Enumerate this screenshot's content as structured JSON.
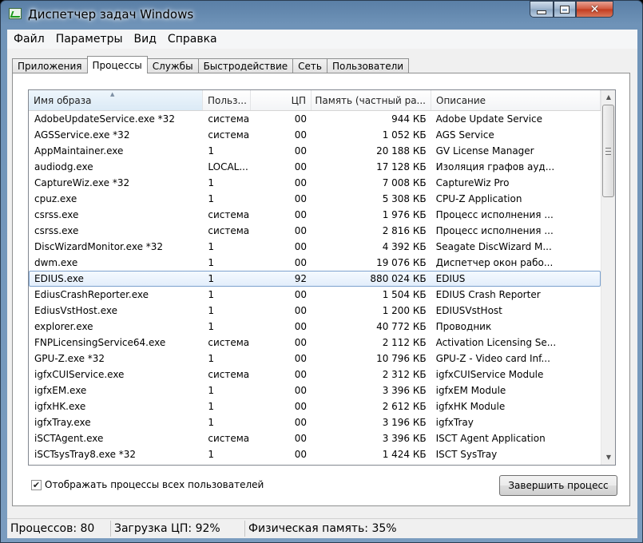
{
  "window": {
    "title": "Диспетчер задач Windows"
  },
  "menu": [
    "Файл",
    "Параметры",
    "Вид",
    "Справка"
  ],
  "tabs": [
    {
      "label": "Приложения"
    },
    {
      "label": "Процессы",
      "active": true
    },
    {
      "label": "Службы"
    },
    {
      "label": "Быстродействие"
    },
    {
      "label": "Сеть"
    },
    {
      "label": "Пользователи"
    }
  ],
  "table": {
    "columns": [
      "Имя образа",
      "Польз...",
      "ЦП",
      "Память (частный ра...",
      "Описание"
    ],
    "sorted_column": 0,
    "selected_row": 10,
    "rows": [
      [
        "AdobeUpdateService.exe *32",
        "система",
        "00",
        "944 КБ",
        "Adobe Update Service"
      ],
      [
        "AGSService.exe *32",
        "система",
        "00",
        "1 052 КБ",
        "AGS Service"
      ],
      [
        "AppMaintainer.exe",
        "1",
        "00",
        "20 188 КБ",
        "GV License Manager"
      ],
      [
        "audiodg.exe",
        "LOCAL...",
        "00",
        "17 128 КБ",
        "Изоляция графов ауд..."
      ],
      [
        "CaptureWiz.exe *32",
        "1",
        "00",
        "7 008 КБ",
        "CaptureWiz Pro"
      ],
      [
        "cpuz.exe",
        "1",
        "00",
        "5 308 КБ",
        "CPU-Z Application"
      ],
      [
        "csrss.exe",
        "система",
        "00",
        "1 976 КБ",
        "Процесс исполнения ..."
      ],
      [
        "csrss.exe",
        "система",
        "00",
        "2 816 КБ",
        "Процесс исполнения ..."
      ],
      [
        "DiscWizardMonitor.exe *32",
        "1",
        "00",
        "4 392 КБ",
        "Seagate DiscWizard M..."
      ],
      [
        "dwm.exe",
        "1",
        "00",
        "19 076 КБ",
        "Диспетчер окон рабо..."
      ],
      [
        "EDIUS.exe",
        "1",
        "92",
        "880 024 КБ",
        "EDIUS"
      ],
      [
        "EdiusCrashReporter.exe",
        "1",
        "00",
        "1 504 КБ",
        "EDIUS Crash Reporter"
      ],
      [
        "EdiusVstHost.exe",
        "1",
        "00",
        "1 200 КБ",
        "EDIUSVstHost"
      ],
      [
        "explorer.exe",
        "1",
        "00",
        "40 772 КБ",
        "Проводник"
      ],
      [
        "FNPLicensingService64.exe",
        "система",
        "00",
        "2 112 КБ",
        "Activation Licensing Se..."
      ],
      [
        "GPU-Z.exe *32",
        "1",
        "00",
        "10 796 КБ",
        "GPU-Z - Video card Inf..."
      ],
      [
        "igfxCUIService.exe",
        "система",
        "00",
        "2 312 КБ",
        "igfxCUIService Module"
      ],
      [
        "igfxEM.exe",
        "1",
        "00",
        "3 396 КБ",
        "igfxEM Module"
      ],
      [
        "igfxHK.exe",
        "1",
        "00",
        "2 612 КБ",
        "igfxHK Module"
      ],
      [
        "igfxTray.exe",
        "1",
        "00",
        "3 196 КБ",
        "igfxTray"
      ],
      [
        "iSCTAgent.exe",
        "система",
        "00",
        "3 396 КБ",
        "ISCT Agent Application"
      ],
      [
        "iSCTsysTray8.exe *32",
        "1",
        "00",
        "1 424 КБ",
        "ISCT SysTray"
      ]
    ]
  },
  "show_all_users": {
    "label": "Отображать процессы всех пользователей",
    "checked": true
  },
  "end_process_label": "Завершить процесс",
  "status": {
    "processes": "Процессов: 80",
    "cpu": "Загрузка ЦП: 92%",
    "memory": "Физическая память: 35%"
  }
}
